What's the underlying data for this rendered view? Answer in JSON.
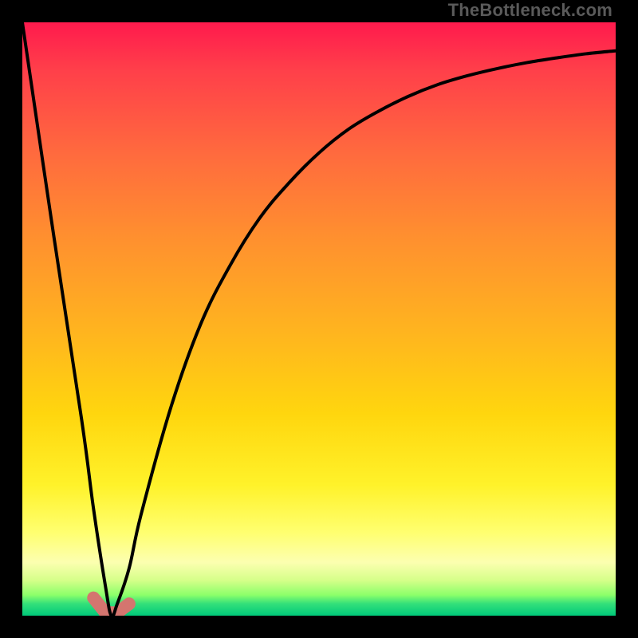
{
  "watermark": "TheBottleneck.com",
  "palette": {
    "top": "#ff1a4d",
    "mid": "#ffd60e",
    "bottom": "#00c97a",
    "curve": "#000000",
    "hook": "#d4756f",
    "background": "#000000"
  },
  "chart_data": {
    "type": "line",
    "title": "",
    "xlabel": "",
    "ylabel": "",
    "xlim": [
      0,
      100
    ],
    "ylim": [
      0,
      100
    ],
    "note": "Bottleneck-style curve. x is normalized component ratio; y is bottleneck percentage. Minimum near x≈15.",
    "x": [
      0,
      5,
      10,
      12,
      14,
      15,
      16,
      18,
      20,
      25,
      30,
      35,
      40,
      45,
      50,
      55,
      60,
      65,
      70,
      75,
      80,
      85,
      90,
      95,
      100
    ],
    "y": [
      100,
      66,
      33,
      18,
      5,
      0,
      2,
      8,
      17,
      35,
      49,
      59,
      67,
      73,
      78,
      82,
      85,
      87.5,
      89.5,
      91,
      92.2,
      93.2,
      94,
      94.7,
      95.2
    ],
    "minimum": {
      "x": 15,
      "y": 0
    },
    "hook_segment": {
      "x": [
        12,
        14,
        16,
        18
      ],
      "y": [
        3,
        0.5,
        0.5,
        2
      ]
    }
  }
}
